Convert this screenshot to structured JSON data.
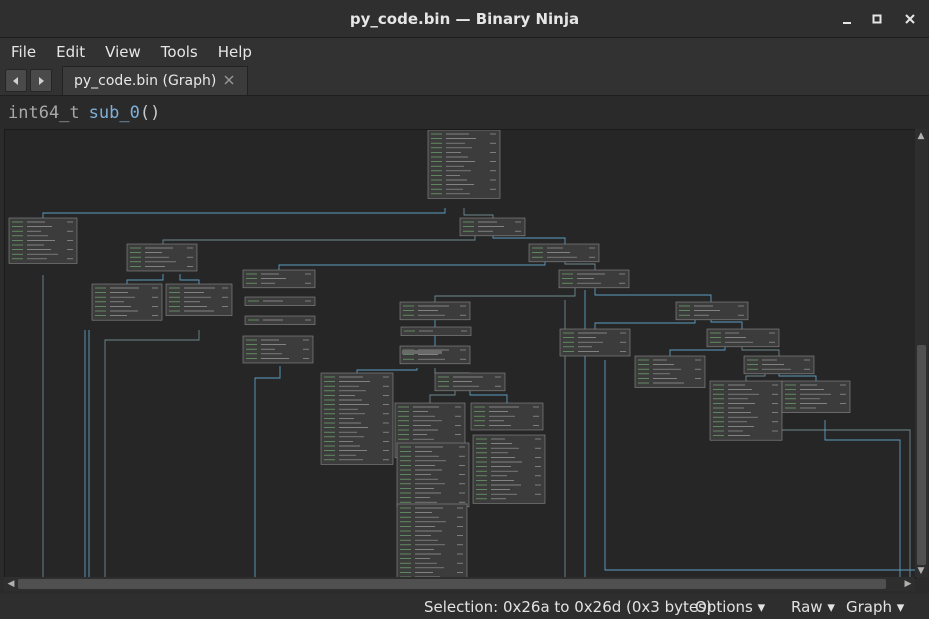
{
  "window": {
    "title": "py_code.bin — Binary Ninja"
  },
  "menu": [
    "File",
    "Edit",
    "View",
    "Tools",
    "Help"
  ],
  "tab": {
    "label": "py_code.bin (Graph)"
  },
  "signature": {
    "ret_type": "int64_t",
    "func_name": "sub_0",
    "parens": "()"
  },
  "status": {
    "selection": "Selection: 0x26a to 0x26d (0x3 bytes)",
    "options": "Options ▾",
    "raw": "Raw ▾",
    "graph": "Graph ▾"
  },
  "colors": {
    "accent": "#7fb0d8",
    "edge_true": "#5c9ec4",
    "edge_false": "#6f8a8f",
    "address": "#6fa86f"
  },
  "icons": {
    "back": "left-arrow-icon",
    "forward": "right-arrow-icon",
    "tab_close": "close-icon",
    "minimize": "minimize-icon",
    "maximize": "maximize-icon",
    "close": "close-icon"
  }
}
